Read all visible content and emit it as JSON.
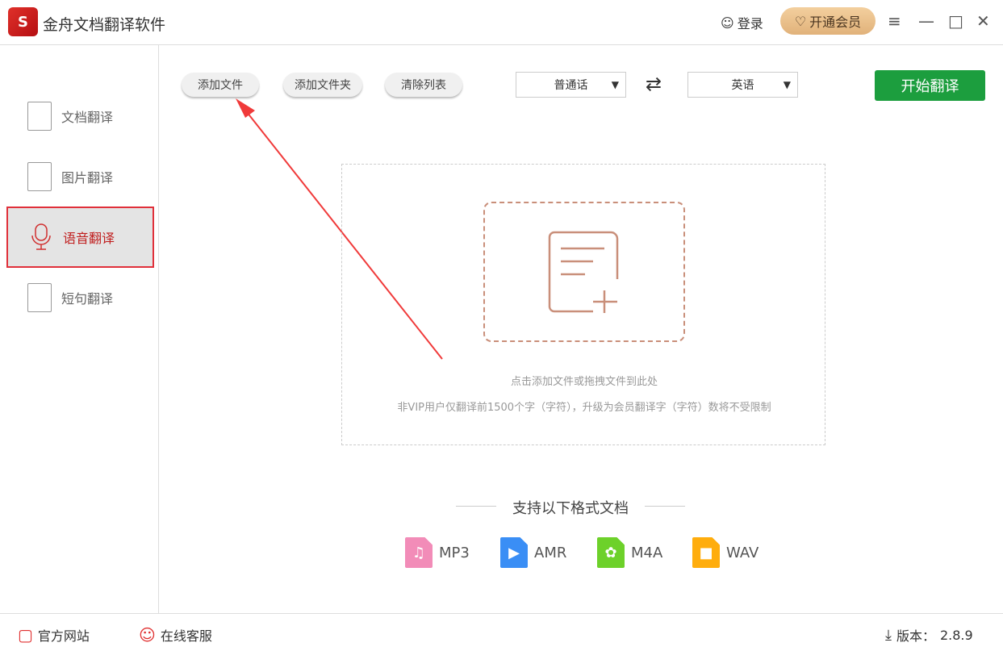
{
  "app": {
    "title": "金舟文档翻译软件",
    "login": "登录",
    "vip": "开通会员"
  },
  "sidebar": {
    "items": [
      {
        "label": "文档翻译"
      },
      {
        "label": "图片翻译"
      },
      {
        "label": "语音翻译"
      },
      {
        "label": "短句翻译"
      }
    ]
  },
  "toolbar": {
    "add_file": "添加文件",
    "add_folder": "添加文件夹",
    "clear_list": "清除列表",
    "source_lang": "普通话",
    "target_lang": "英语",
    "start": "开始翻译"
  },
  "drop": {
    "hint1": "点击添加文件或拖拽文件到此处",
    "hint2": "非VIP用户仅翻译前1500个字（字符），升级为会员翻译字（字符）数将不受限制"
  },
  "formats": {
    "title": "支持以下格式文档",
    "items": [
      {
        "label": "MP3",
        "color": "#f28cb8"
      },
      {
        "label": "AMR",
        "color": "#3a8ef5"
      },
      {
        "label": "M4A",
        "color": "#6dd12a"
      },
      {
        "label": "WAV",
        "color": "#ffad0d"
      }
    ]
  },
  "footer": {
    "website": "官方网站",
    "support": "在线客服",
    "version_label": "版本：",
    "version": "2.8.9"
  }
}
